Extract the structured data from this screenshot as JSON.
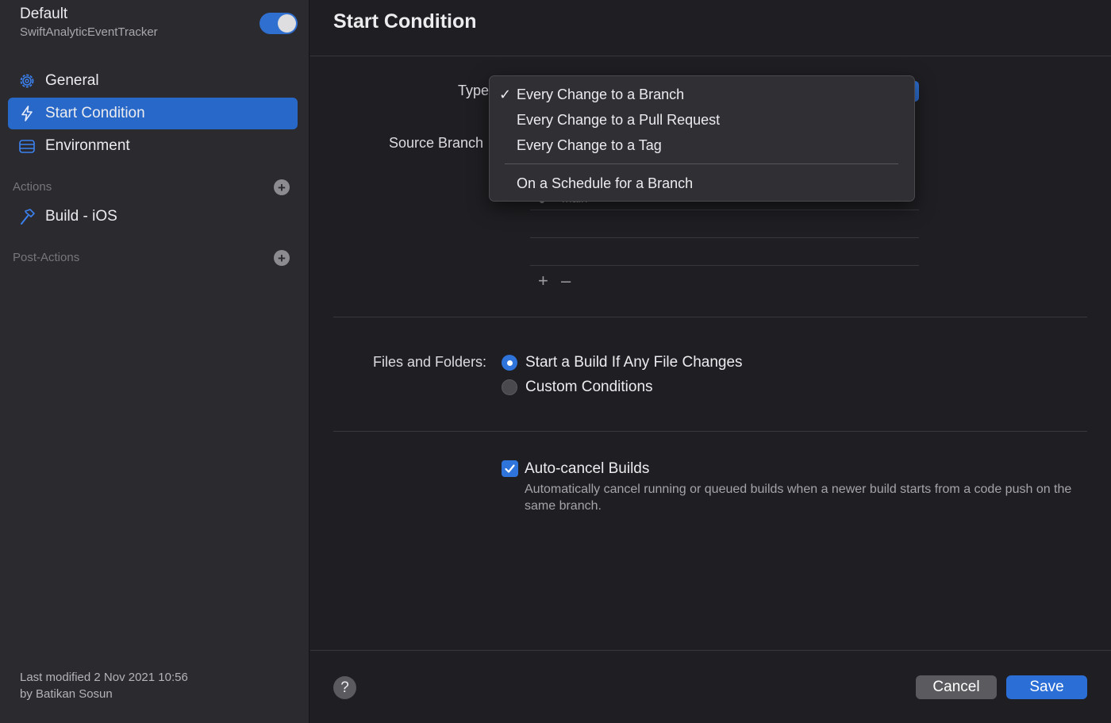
{
  "sidebar": {
    "workflow_name": "Default",
    "product_name": "SwiftAnalyticEventTracker",
    "enabled": true,
    "nav": [
      {
        "label": "General",
        "icon": "gear-icon",
        "selected": false
      },
      {
        "label": "Start Condition",
        "icon": "bolt-icon",
        "selected": true
      },
      {
        "label": "Environment",
        "icon": "environment-icon",
        "selected": false
      }
    ],
    "actions_header": "Actions",
    "actions": [
      {
        "label": "Build - iOS",
        "icon": "hammer-icon"
      }
    ],
    "post_actions_header": "Post-Actions",
    "footer": {
      "modified": "Last modified 2 Nov 2021 10:56",
      "author": "by Batikan Sosun"
    }
  },
  "main": {
    "title": "Start Condition",
    "type_label": "Type",
    "source_branch_label": "Source Branch",
    "branch_value": "main",
    "add_symbol": "+",
    "remove_symbol": "–",
    "files_label": "Files and Folders:",
    "files_options": [
      {
        "label": "Start a Build If Any File Changes",
        "selected": true
      },
      {
        "label": "Custom Conditions",
        "selected": false
      }
    ],
    "auto_cancel": {
      "label": "Auto-cancel Builds",
      "checked": true,
      "description": "Automatically cancel running or queued builds when a newer build starts from a code push on the same branch."
    },
    "help_symbol": "?",
    "cancel_label": "Cancel",
    "save_label": "Save"
  },
  "type_menu": {
    "check_mark": "✓",
    "items": [
      {
        "label": "Every Change to a Branch",
        "checked": true
      },
      {
        "label": "Every Change to a Pull Request",
        "checked": false
      },
      {
        "label": "Every Change to a Tag",
        "checked": false
      },
      {
        "label": "On a Schedule for a Branch",
        "checked": false
      }
    ]
  },
  "colors": {
    "accent": "#2f74db",
    "sidebar_bg": "#2b2a2f",
    "main_bg": "#1f1e22"
  }
}
